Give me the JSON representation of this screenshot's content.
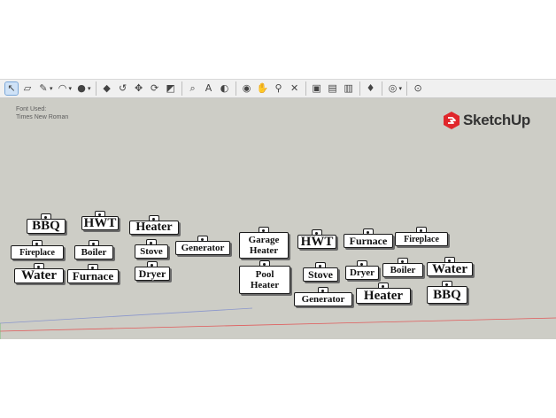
{
  "toolbar": {
    "tools": [
      {
        "name": "select-tool-icon",
        "glyph": "↖",
        "active": true
      },
      {
        "name": "eraser-tool-icon",
        "glyph": "▱"
      },
      {
        "name": "line-tool-icon",
        "glyph": "✎",
        "dropdown": true
      },
      {
        "name": "arc-tool-icon",
        "glyph": "◠",
        "dropdown": true
      },
      {
        "name": "shapes-tool-icon",
        "glyph": "●",
        "dropdown": true
      },
      {
        "sep": true
      },
      {
        "name": "push-pull-tool-icon",
        "glyph": "◆"
      },
      {
        "name": "offset-tool-icon",
        "glyph": "↺"
      },
      {
        "name": "move-tool-icon",
        "glyph": "✥"
      },
      {
        "name": "rotate-tool-icon",
        "glyph": "⟳"
      },
      {
        "name": "scale-tool-icon",
        "glyph": "◩"
      },
      {
        "sep": true
      },
      {
        "name": "tape-measure-tool-icon",
        "glyph": "⌕"
      },
      {
        "name": "text-tool-icon",
        "glyph": "A"
      },
      {
        "name": "paint-bucket-tool-icon",
        "glyph": "◐"
      },
      {
        "sep": true
      },
      {
        "name": "orbit-tool-icon",
        "glyph": "◉"
      },
      {
        "name": "pan-tool-icon",
        "glyph": "✋"
      },
      {
        "name": "zoom-tool-icon",
        "glyph": "⚲"
      },
      {
        "name": "zoom-extents-tool-icon",
        "glyph": "✕"
      },
      {
        "sep": true
      },
      {
        "name": "warehouse-icon",
        "glyph": "▣"
      },
      {
        "name": "extension-warehouse-icon",
        "glyph": "▤"
      },
      {
        "name": "send-to-layout-icon",
        "glyph": "▥"
      },
      {
        "sep": true
      },
      {
        "name": "extension-manager-icon",
        "glyph": "♦"
      },
      {
        "sep": true
      },
      {
        "name": "user-account-icon",
        "glyph": "◎",
        "dropdown": true
      },
      {
        "sep": true
      },
      {
        "name": "help-icon",
        "glyph": "⊙"
      }
    ]
  },
  "viewport": {
    "font_note_line1": "Font Used:",
    "font_note_line2": "Times New Roman",
    "logo_text": "SketchUp",
    "logo_color": "#e0262b",
    "background_color": "#cdcdc6"
  },
  "tags": [
    {
      "line1": "BBQ"
    },
    {
      "line1": "HWT"
    },
    {
      "line1": "Heater"
    },
    {
      "line1": "Fireplace"
    },
    {
      "line1": "Boiler"
    },
    {
      "line1": "Stove"
    },
    {
      "line1": "Generator"
    },
    {
      "line1": "Water"
    },
    {
      "line1": "Furnace"
    },
    {
      "line1": "Dryer"
    },
    {
      "line1": "Garage",
      "line2": "Heater"
    },
    {
      "line1": "HWT"
    },
    {
      "line1": "Furnace"
    },
    {
      "line1": "Fireplace"
    },
    {
      "line1": "Pool",
      "line2": "Heater"
    },
    {
      "line1": "Stove"
    },
    {
      "line1": "Dryer"
    },
    {
      "line1": "Boiler"
    },
    {
      "line1": "Water"
    },
    {
      "line1": "Generator"
    },
    {
      "line1": "Heater"
    },
    {
      "line1": "BBQ"
    }
  ]
}
